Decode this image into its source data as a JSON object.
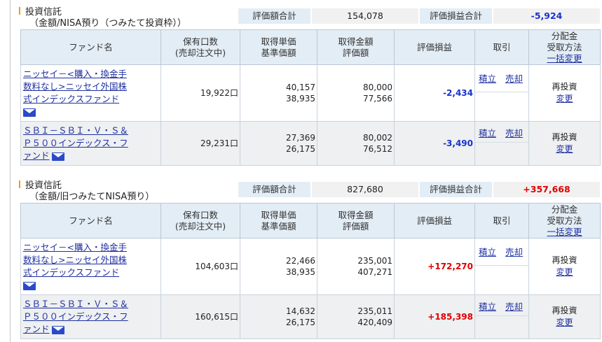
{
  "sections": [
    {
      "title_line1": "投資信託",
      "title_line2": "（金額/NISA預り（つみたて投資枠））",
      "summary": {
        "value_label": "評価額合計",
        "value": "154,078",
        "pl_label": "評価損益合計",
        "pl": "-5,924"
      },
      "headers": {
        "fund": "ファンド名",
        "units_1": "保有口数",
        "units_2": "(売却注文中)",
        "price_1": "取得単価",
        "price_2": "基準価額",
        "amount_1": "取得金額",
        "amount_2": "評価額",
        "pl": "評価損益",
        "trade": "取引",
        "dist_1": "分配金",
        "dist_2": "受取方法",
        "dist_3": "一括変更"
      },
      "rows": [
        {
          "name_lines": [
            "ニッセイ－<購入・換金手",
            "数料なし>ニッセイ外国株",
            "式インデックスファンド"
          ],
          "units": "19,922口",
          "cost_price": "40,157",
          "nav": "38,935",
          "cost_amount": "80,000",
          "value": "77,566",
          "pl": "-2,434",
          "buy": "積立",
          "sell": "売却",
          "method": "再投資",
          "change": "変更"
        },
        {
          "name_lines": [
            "ＳＢＩ－ＳＢＩ・Ｖ・Ｓ＆",
            "Ｐ５００インデックス・フ",
            "ァンド"
          ],
          "units": "29,231口",
          "cost_price": "27,369",
          "nav": "26,175",
          "cost_amount": "80,002",
          "value": "76,512",
          "pl": "-3,490",
          "buy": "積立",
          "sell": "売却",
          "method": "再投資",
          "change": "変更"
        }
      ]
    },
    {
      "title_line1": "投資信託",
      "title_line2": "（金額/旧つみたてNISA預り）",
      "summary": {
        "value_label": "評価額合計",
        "value": "827,680",
        "pl_label": "評価損益合計",
        "pl": "+357,668"
      },
      "headers": {
        "fund": "ファンド名",
        "units_1": "保有口数",
        "units_2": "(売却注文中)",
        "price_1": "取得単価",
        "price_2": "基準価額",
        "amount_1": "取得金額",
        "amount_2": "評価額",
        "pl": "評価損益",
        "trade": "取引",
        "dist_1": "分配金",
        "dist_2": "受取方法",
        "dist_3": "一括変更"
      },
      "rows": [
        {
          "name_lines": [
            "ニッセイ－<購入・換金手",
            "数料なし>ニッセイ外国株",
            "式インデックスファンド"
          ],
          "units": "104,603口",
          "cost_price": "22,466",
          "nav": "38,935",
          "cost_amount": "235,001",
          "value": "407,271",
          "pl": "+172,270",
          "buy": "積立",
          "sell": "売却",
          "method": "再投資",
          "change": "変更"
        },
        {
          "name_lines": [
            "ＳＢＩ－ＳＢＩ・Ｖ・Ｓ＆",
            "Ｐ５００インデックス・フ",
            "ァンド"
          ],
          "units": "160,615口",
          "cost_price": "14,632",
          "nav": "26,175",
          "cost_amount": "235,011",
          "value": "420,409",
          "pl": "+185,398",
          "buy": "積立",
          "sell": "売却",
          "method": "再投資",
          "change": "変更"
        }
      ]
    }
  ],
  "icons": {
    "mail": "mail-icon"
  },
  "colors": {
    "negative": "#1a33cc",
    "positive": "#e00000",
    "header_bg": "#e3edf5",
    "link": "#2030a0",
    "accent_bar": "#e9a400"
  }
}
